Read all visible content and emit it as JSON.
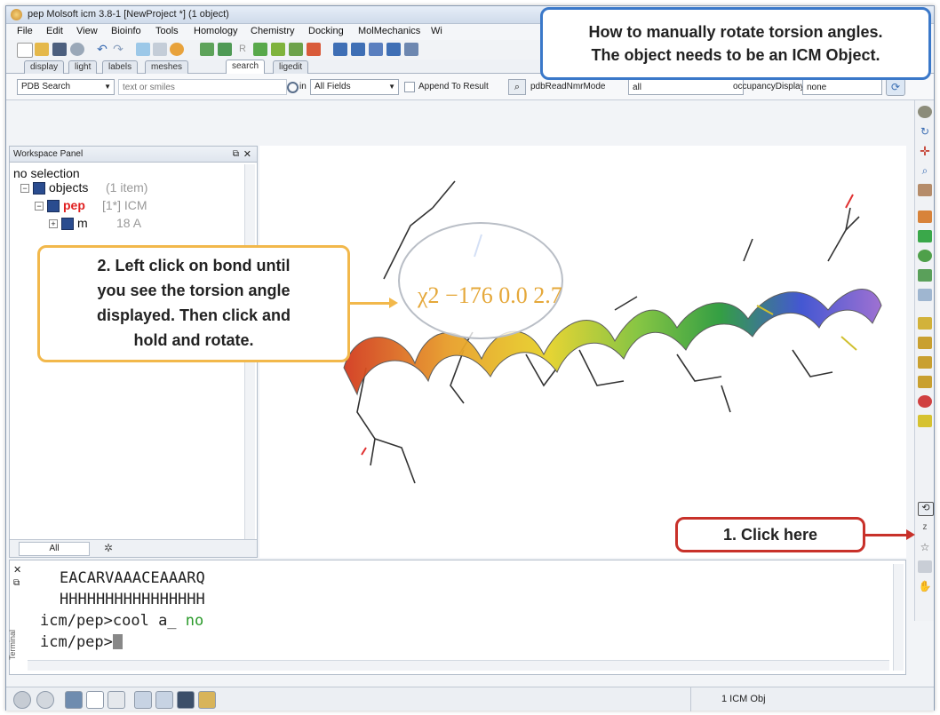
{
  "window": {
    "title": "pep Molsoft icm 3.8-1  [NewProject *] (1 object)"
  },
  "menubar": {
    "items": [
      "File",
      "Edit",
      "View",
      "Bioinfo",
      "Tools",
      "Homology",
      "Chemistry",
      "Docking",
      "MolMechanics",
      "Wi"
    ]
  },
  "tabs": [
    {
      "label": "display",
      "active": false
    },
    {
      "label": "light",
      "active": false
    },
    {
      "label": "labels",
      "active": false
    },
    {
      "label": "meshes",
      "active": false
    },
    {
      "label": "search",
      "active": true
    },
    {
      "label": "ligedit",
      "active": false
    }
  ],
  "search": {
    "mode": "PDB Search",
    "placeholder": "text or smiles",
    "field_prefix": "in",
    "fields": "All Fields",
    "append_label": "Append To Result",
    "nmr_label": "pdbReadNmrMode",
    "nmr_value": "all",
    "occupancy_label": "occupancyDisplay",
    "occupancy_value": "none"
  },
  "workspace": {
    "title": "Workspace Panel",
    "selection": "no selection",
    "objects_label": "objects",
    "objects_count": "(1 item)",
    "pep_label": "pep",
    "pep_meta": "[1*] ICM",
    "mol_label": "m",
    "mol_meta": "18 A",
    "tab_all": "All"
  },
  "terminal": {
    "label": "Terminal",
    "lines": [
      "EACARVAAACEAAARQ",
      "HHHHHHHHHHHHHHHH"
    ],
    "prompt1": "icm/pep>",
    "cmd1": "cool a_ ",
    "cmd1_kw": "no",
    "prompt2": "icm/pep>"
  },
  "viewport": {
    "torsion_label": "χ2 −176 0.0 2.7"
  },
  "statusbar": {
    "text": "1 ICM Obj"
  },
  "callouts": {
    "top": [
      "How to manually rotate torsion angles.",
      "The object needs to be an ICM Object."
    ],
    "left": [
      "2. Left click on bond until",
      "you see the torsion angle",
      "displayed. Then click and",
      "hold and rotate."
    ],
    "right": "1. Click here"
  },
  "colors": {
    "callout_orange": "#f2b84b",
    "callout_red": "#c8312a",
    "callout_blue": "#3a78c9",
    "tree_pep": "#e02020"
  }
}
